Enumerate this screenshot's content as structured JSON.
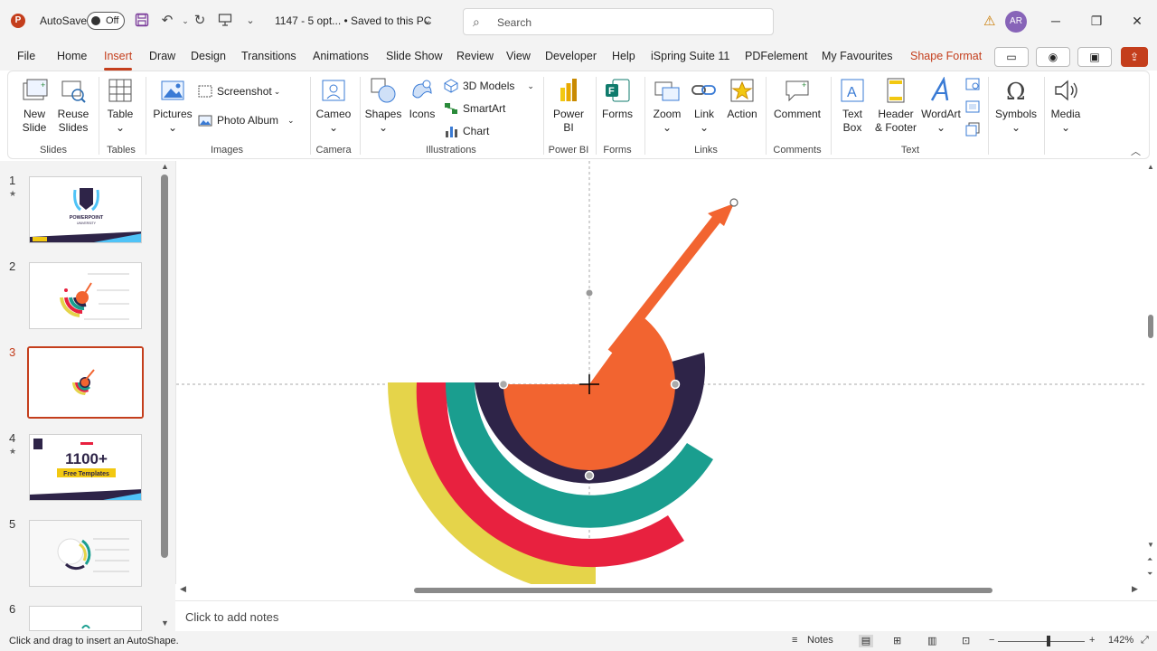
{
  "titlebar": {
    "app_icon": "P",
    "autosave_label": "AutoSave",
    "autosave_state": "Off",
    "doc_title": "1147 - 5 opt... • Saved to this PC",
    "search_placeholder": "Search",
    "avatar_initials": "AR"
  },
  "tabs": [
    "File",
    "Home",
    "Insert",
    "Draw",
    "Design",
    "Transitions",
    "Animations",
    "Slide Show",
    "Review",
    "View",
    "Developer",
    "Help",
    "iSpring Suite 11",
    "PDFelement",
    "My Favourites",
    "Shape Format"
  ],
  "ribbon": {
    "new_slide": "New",
    "new_slide2": "Slide",
    "reuse": "Reuse",
    "reuse2": "Slides",
    "table": "Table",
    "pictures": "Pictures",
    "screenshot": "Screenshot",
    "photo_album": "Photo Album",
    "cameo": "Cameo",
    "shapes": "Shapes",
    "icons": "Icons",
    "models3d": "3D Models",
    "smartart": "SmartArt",
    "chart": "Chart",
    "powerbi": "Power",
    "powerbi2": "BI",
    "forms": "Forms",
    "zoom": "Zoom",
    "link": "Link",
    "action": "Action",
    "comment": "Comment",
    "textbox": "Text",
    "textbox2": "Box",
    "header": "Header",
    "header2": "& Footer",
    "wordart": "WordArt",
    "symbols": "Symbols",
    "media": "Media",
    "groups": {
      "slides": "Slides",
      "tables": "Tables",
      "images": "Images",
      "camera": "Camera",
      "illustrations": "Illustrations",
      "powerbi": "Power BI",
      "forms": "Forms",
      "links": "Links",
      "comments": "Comments",
      "text": "Text"
    }
  },
  "slides": [
    {
      "num": "1",
      "star": "★"
    },
    {
      "num": "2",
      "star": ""
    },
    {
      "num": "3",
      "star": ""
    },
    {
      "num": "4",
      "star": "★"
    },
    {
      "num": "5",
      "star": ""
    },
    {
      "num": "6",
      "star": ""
    }
  ],
  "thumb1": {
    "title": "POWERPOINT",
    "sub": "UNIVERSITY"
  },
  "thumb4": {
    "big": "1100+",
    "sub": "Free Templates"
  },
  "notes_placeholder": "Click to add notes",
  "status": {
    "message": "Click and drag to insert an AutoShape.",
    "notes": "Notes",
    "zoom": "142%"
  },
  "colors": {
    "accent": "#c43e1c",
    "orange": "#f26430",
    "navy": "#2e2448",
    "teal": "#1a9e8f",
    "red": "#e8213f",
    "yellow": "#e5d44a"
  }
}
